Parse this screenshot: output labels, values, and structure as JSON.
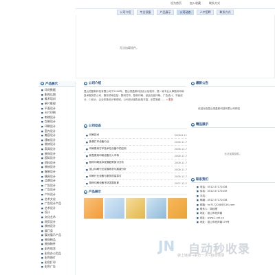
{
  "header": {
    "links": [
      "设为首页",
      "加入收藏",
      "联系方式"
    ],
    "nav": [
      "公司介绍",
      "专业设备",
      "产品展示",
      "公司动态",
      "人才招聘",
      "联系方式"
    ],
    "banner_text": "无法加载插件。"
  },
  "sidebar": {
    "title": "产品展示",
    "items": [
      "印花数据",
      "影视后期",
      "美术培训",
      "单片影视",
      "平面设计",
      "卡片印刷",
      "刺绣设计",
      "包装设计",
      "印刷设计",
      "室内设计",
      "美容设计",
      "建筑设计",
      "装修设计",
      "家具设计",
      "装饰设计",
      "国际设计",
      "资料设计",
      "装修设计",
      "服装设计",
      "模具设计",
      "品牌设计",
      "广告设计",
      "广告设计",
      "户外设计",
      "艺术文化",
      "广告设计产品",
      "艺术设计",
      "设计",
      "文化艺术",
      "网页设计",
      "装修设计",
      "展厅类",
      "展览展示产品",
      "装饰物品",
      "装饰物件",
      "彩色喷涂",
      "彩色办公用品",
      "彩色照片",
      "彩色打印",
      "彩色广告",
      "装修艺术设计",
      "平面设计",
      "设计",
      "设计"
    ]
  },
  "about": {
    "title": "公司介绍",
    "text": "昆山恒盈新科技有限公司于2006年，昆山恒盈新科技设计及制作，是一家专业从事数码印刷技术服务的公司，服务领域包括：数码打印、数码印刷、纸品包装印刷、广告设计、平面设计、CI设计、企业形象设计等领域。公司设计团队经验丰富，创意新颖……",
    "more": "更多"
  },
  "news": {
    "title": "公司动态",
    "rows": [
      {
        "text": "印刷技术",
        "date": "2008.8.11"
      },
      {
        "text": "影像打印设备行业",
        "date": "2008.11.7"
      },
      {
        "text": "印刷数码打印技术在设备中的应用",
        "date": "2008.11.7"
      },
      {
        "text": "新型数码印刷设备引入市场",
        "date": "2008.11.7"
      },
      {
        "text": "数码印刷技术发展趋势探讨分析",
        "date": "2008.11.7"
      },
      {
        "text": "昆山印刷行业发展现状与展望分析",
        "date": "2008.11.7"
      },
      {
        "text": "印刷行业设备与服务质量探讨",
        "date": "2008.11.7"
      },
      {
        "text": "数码印刷设备市场发展前景",
        "date": "2007.12.2"
      }
    ]
  },
  "products": {
    "title": "产品展示"
  },
  "announce": {
    "title": "最新公告",
    "text": "欢迎光临昆山恒盈新科技有限公司网站"
  },
  "featured": {
    "title": "精品展示",
    "text": "无法加载插件。"
  },
  "contact": {
    "title": "联系我们",
    "lines": [
      "电话：0512-57172038",
      "传真：0512-57172039",
      "手机：",
      "邮编：0512-57172038",
      "邮箱：hn7172038@126.com",
      "联系人：周经理",
      "地址：昆山市柏庐路",
      "网址：www.2.net.cn",
      "地址：昆山市柏庐路179号"
    ]
  },
  "watermark": {
    "brand": "自动秒收录",
    "sub": "做上链接→来访一次→自动收录"
  },
  "colors": {
    "accent": "#1c4e8a",
    "nav_bg": "#e4edf6"
  }
}
